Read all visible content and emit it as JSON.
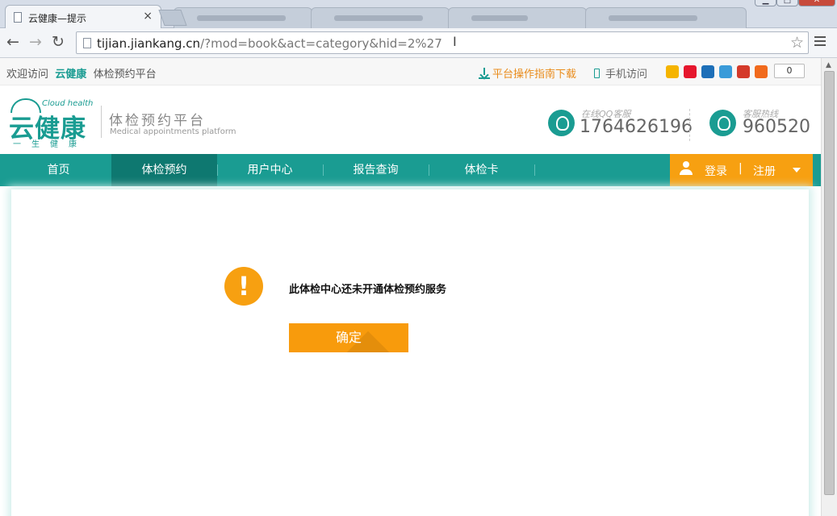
{
  "browser": {
    "active_tab_title": "云健康—提示",
    "tab_close": "×",
    "url_host": "tijian.jiankang.cn",
    "url_path": "/?mod=book&act=category&hid=2%27",
    "window_minimize": "▁",
    "window_maximize": "□",
    "window_close": "✕",
    "back_glyph": "←",
    "forward_glyph": "→",
    "reload_glyph": "↻",
    "star_glyph": "☆",
    "cursor_glyph": "I"
  },
  "topbar": {
    "welcome_prefix": "欢迎访问",
    "brand": "云健康",
    "welcome_suffix": "体检预约平台",
    "guide_download": "平台操作指南下载",
    "mobile_access": "手机访问",
    "share_count": "0",
    "share_icons": [
      {
        "name": "qzone-icon",
        "color": "#f5b400"
      },
      {
        "name": "weibo-icon",
        "color": "#e6162d"
      },
      {
        "name": "renren-icon",
        "color": "#1d6fb8"
      },
      {
        "name": "tencent-weibo-icon",
        "color": "#3a9bd9"
      },
      {
        "name": "baidu-icon",
        "color": "#d43a2a"
      },
      {
        "name": "more-share-icon",
        "color": "#f16a1c"
      }
    ]
  },
  "header": {
    "logo_en": "Cloud health",
    "logo_cn": "云健康",
    "logo_sub": "一生健康",
    "platform_cn": "体检预约平台",
    "platform_en": "Medical appointments platform",
    "qq_label": "在线QQ客服",
    "qq_number": "1764626196",
    "hotline_label": "客服热线",
    "hotline_number": "960520"
  },
  "nav": {
    "items": [
      {
        "label": "首页"
      },
      {
        "label": "体检预约"
      },
      {
        "label": "用户中心"
      },
      {
        "label": "报告查询"
      },
      {
        "label": "体检卡"
      }
    ],
    "active_index": 1,
    "login": "登录",
    "separator": "|",
    "register": "注册"
  },
  "alert": {
    "icon_glyph": "!",
    "message": "此体检中心还未开通体检预约服务",
    "confirm": "确定"
  },
  "colors": {
    "teal": "#1a9c92",
    "teal_dark": "#0e7870",
    "orange": "#f7a011"
  }
}
